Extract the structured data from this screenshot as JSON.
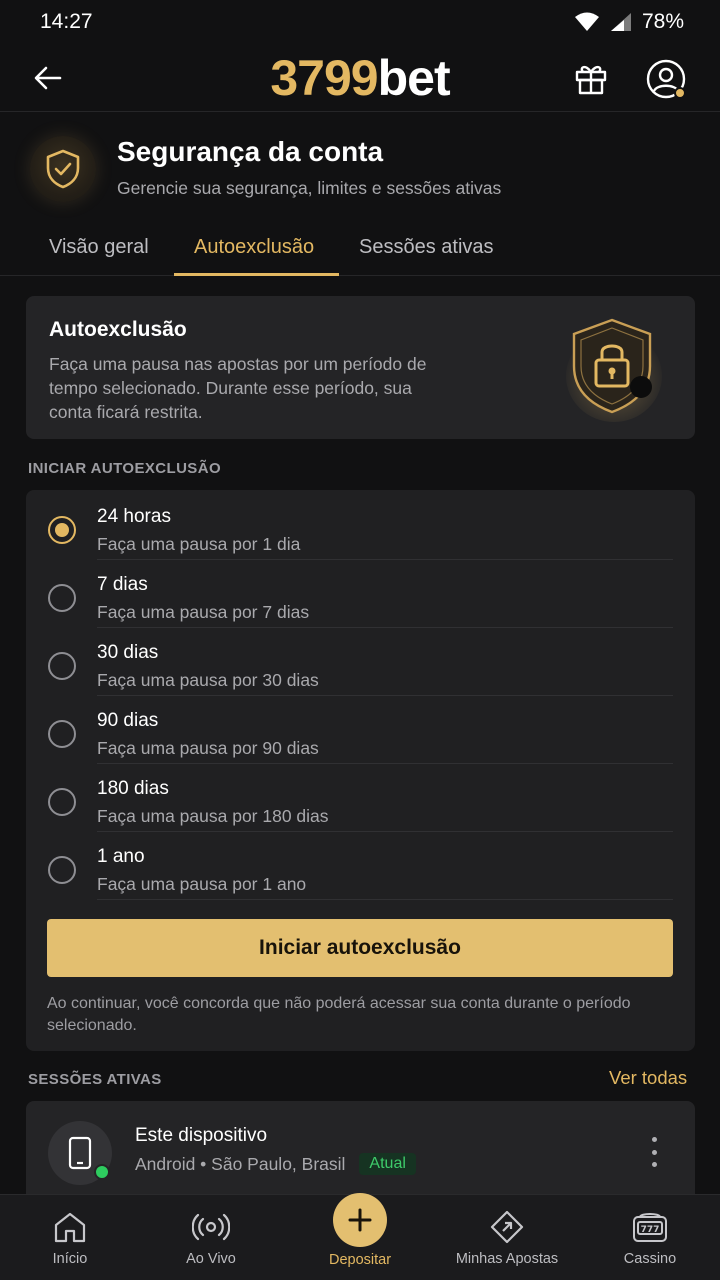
{
  "status_bar": {
    "time": "14:27",
    "battery": "78%"
  },
  "header": {
    "brand_number": "3799",
    "brand_text": "bet"
  },
  "page": {
    "title": "Segurança da conta",
    "subtitle": "Gerencie sua segurança, limites e sessões ativas",
    "tabs": [
      {
        "label": "Visão geral",
        "active": false
      },
      {
        "label": "Autoexclusão",
        "active": true
      },
      {
        "label": "Sessões ativas",
        "active": false
      }
    ]
  },
  "info_card": {
    "title": "Autoexclusão",
    "description": "Faça uma pausa nas apostas por um período de tempo selecionado. Durante esse período, sua conta ficará restrita."
  },
  "self_exclusion": {
    "section_label": "INICIAR AUTOEXCLUSÃO",
    "options": [
      {
        "label": "24 horas",
        "description": "Faça uma pausa por 1 dia",
        "selected": true
      },
      {
        "label": "7 dias",
        "description": "Faça uma pausa por 7 dias",
        "selected": false
      },
      {
        "label": "30 dias",
        "description": "Faça uma pausa por 30 dias",
        "selected": false
      },
      {
        "label": "90 dias",
        "description": "Faça uma pausa por 90 dias",
        "selected": false
      },
      {
        "label": "180 dias",
        "description": "Faça uma pausa por 180 dias",
        "selected": false
      },
      {
        "label": "1 ano",
        "description": "Faça uma pausa por 1 ano",
        "selected": false
      }
    ],
    "button_label": "Iniciar autoexclusão",
    "disclaimer": "Ao continuar, você concorda que não poderá acessar sua conta durante o período selecionado."
  },
  "sessions": {
    "section_label": "SESSÕES ATIVAS",
    "see_all": "Ver todas",
    "current": {
      "title": "Este dispositivo",
      "details": "Android • São Paulo, Brasil",
      "badge": "Atual"
    }
  },
  "bottom_nav": [
    {
      "label": "Início",
      "icon": "home-icon"
    },
    {
      "label": "Ao Vivo",
      "icon": "live-broadcast-icon"
    },
    {
      "label": "Depositar",
      "icon": "plus-icon"
    },
    {
      "label": "Minhas Apostas",
      "icon": "bet-ticket-icon"
    },
    {
      "label": "Cassino",
      "icon": "slot-machine-icon"
    }
  ],
  "colors": {
    "accent": "#e3b862",
    "background": "#111112",
    "card": "#242426",
    "success": "#2ecc5f"
  }
}
